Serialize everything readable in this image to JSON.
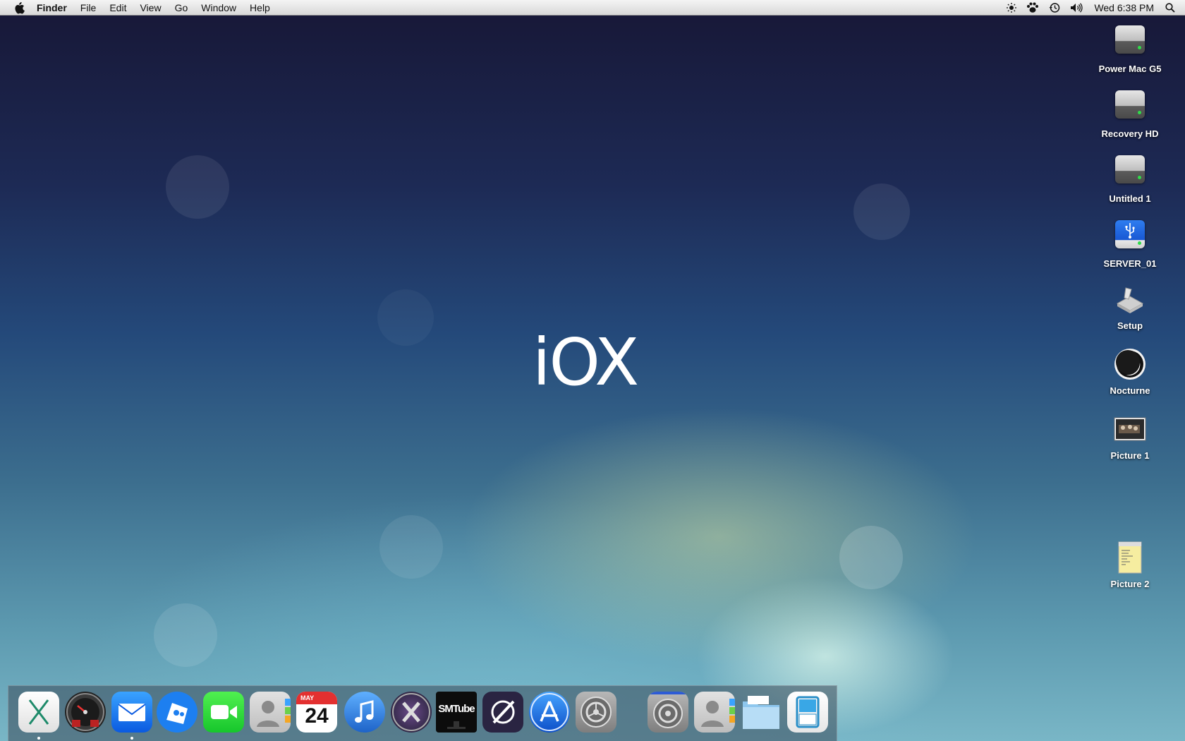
{
  "menubar": {
    "apple_icon": "apple-logo-icon",
    "app_name": "Finder",
    "items": [
      "File",
      "Edit",
      "View",
      "Go",
      "Window",
      "Help"
    ],
    "status_icons": [
      "brightness-icon",
      "paw-icon",
      "time-machine-icon",
      "volume-icon"
    ],
    "clock": "Wed 6:38 PM",
    "search_icon": "spotlight-icon"
  },
  "desktop": {
    "logo_text": "iOX",
    "icons": [
      {
        "label": "Power Mac G5",
        "icon": "hard-drive-icon"
      },
      {
        "label": "Recovery HD",
        "icon": "hard-drive-icon"
      },
      {
        "label": "Untitled 1",
        "icon": "hard-drive-icon"
      },
      {
        "label": "SERVER_01",
        "icon": "usb-drive-icon"
      },
      {
        "label": "Setup",
        "icon": "installer-icon"
      },
      {
        "label": "Nocturne",
        "icon": "nocturne-icon"
      },
      {
        "label": "Picture 1",
        "icon": "image-file-icon"
      },
      {
        "label": "Picture 2",
        "icon": "notes-file-icon"
      }
    ]
  },
  "dock": {
    "calendar_month": "MAY",
    "calendar_day": "24",
    "smtube_label": "SMTube",
    "items": [
      {
        "name": "mac-os-x-icon",
        "running": true
      },
      {
        "name": "dashboard-icon",
        "running": false
      },
      {
        "name": "mail-icon",
        "running": true
      },
      {
        "name": "cyberduck-icon",
        "running": false
      },
      {
        "name": "facetime-icon",
        "running": false
      },
      {
        "name": "contacts-icon",
        "running": false
      },
      {
        "name": "calendar-icon",
        "running": false
      },
      {
        "name": "itunes-icon",
        "running": false
      },
      {
        "name": "mission-control-icon",
        "running": false
      },
      {
        "name": "smtube-icon",
        "running": false
      },
      {
        "name": "scrivener-icon",
        "running": false
      },
      {
        "name": "app-store-icon",
        "running": false
      },
      {
        "name": "system-preferences-icon",
        "running": false
      },
      {
        "name": "system-preferences-stack-icon",
        "running": false
      },
      {
        "name": "contacts-stack-icon",
        "running": false
      },
      {
        "name": "downloads-folder-icon",
        "running": false
      },
      {
        "name": "trash-icon",
        "running": false
      }
    ]
  }
}
